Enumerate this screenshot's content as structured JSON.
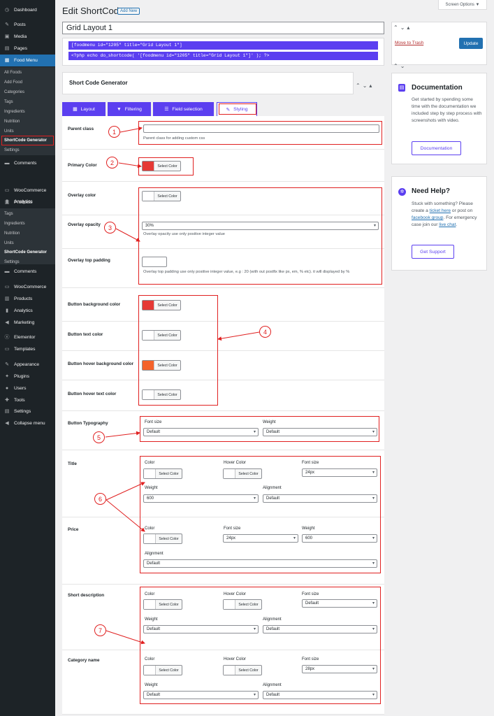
{
  "sidebar": {
    "items": [
      {
        "label": "Dashboard",
        "icon": "dashboard-icon",
        "glyph": "◷"
      },
      {
        "label": "Posts",
        "icon": "pin-icon",
        "glyph": "✎"
      },
      {
        "label": "Media",
        "icon": "media-icon",
        "glyph": "▣"
      },
      {
        "label": "Pages",
        "icon": "page-icon",
        "glyph": "▤"
      },
      {
        "label": "Food Menu",
        "icon": "food-menu-icon",
        "glyph": "▦"
      }
    ],
    "food_submenu": [
      "All Foods",
      "Add Food",
      "Categories",
      "Tags",
      "Ingredients",
      "Nutrition",
      "Units",
      "ShortCode Generator",
      "Settings"
    ],
    "items2": [
      {
        "label": "Comments",
        "icon": "comments-icon",
        "glyph": "▬"
      },
      {
        "label": "WooCommerce",
        "icon": "woocommerce-icon",
        "glyph": "▭"
      },
      {
        "label": "Products",
        "icon": "products-icon",
        "glyph": "▥"
      },
      {
        "label": "Analytics",
        "icon": "analytics-icon",
        "glyph": "▮"
      }
    ],
    "dup_submenu": [
      "Tags",
      "Ingredients",
      "Nutrition",
      "Units",
      "ShortCode Generator",
      "Settings"
    ],
    "items3": [
      {
        "label": "Comments",
        "icon": "comments-icon",
        "glyph": "▬"
      },
      {
        "label": "WooCommerce",
        "icon": "woocommerce-icon",
        "glyph": "▭"
      },
      {
        "label": "Products",
        "icon": "products-icon",
        "glyph": "▥"
      },
      {
        "label": "Analytics",
        "icon": "analytics-icon",
        "glyph": "▮"
      },
      {
        "label": "Marketing",
        "icon": "marketing-icon",
        "glyph": "◀"
      },
      {
        "label": "Elementor",
        "icon": "elementor-icon",
        "glyph": "ⓔ"
      },
      {
        "label": "Templates",
        "icon": "templates-icon",
        "glyph": "▭"
      },
      {
        "label": "Appearance",
        "icon": "appearance-icon",
        "glyph": "✎"
      },
      {
        "label": "Plugins",
        "icon": "plugins-icon",
        "glyph": "✦"
      },
      {
        "label": "Users",
        "icon": "users-icon",
        "glyph": "●"
      },
      {
        "label": "Tools",
        "icon": "tools-icon",
        "glyph": "✚"
      },
      {
        "label": "Settings",
        "icon": "settings-icon",
        "glyph": "▤"
      },
      {
        "label": "Collapse menu",
        "icon": "collapse-icon",
        "glyph": "◀"
      }
    ]
  },
  "header": {
    "title": "Edit ShortCode",
    "add_new": "Add New",
    "screen_options": "Screen Options ▼"
  },
  "post_title": "Grid Layout 1",
  "shortcodes": [
    "[foodmenu id=\"1205\" title=\"Grid Layout 1\"]",
    "<?php echo do_shortcode( '[foodmenu id=\"1205\" title=\"Grid Layout 1\"]' ); ?>"
  ],
  "generator": {
    "title": "Short Code Generator",
    "tabs": [
      "Layout",
      "Filtering",
      "Field selection",
      "Styling"
    ]
  },
  "colors": {
    "accent": "#5b3ff0",
    "red": "#e02020",
    "red_swatch": "#e53935",
    "orange_swatch": "#f4622a",
    "wp_blue": "#2271b1"
  },
  "select_color": "Select Color",
  "fields": {
    "parent_class": {
      "label": "Parent class",
      "help": "Parent class for adding custom css"
    },
    "primary_color": {
      "label": "Primary Color"
    },
    "overlay_color": {
      "label": "Overlay color"
    },
    "overlay_opacity": {
      "label": "Overlay opacity",
      "value": "30%",
      "help": "Overlay opacity use only positive integer value"
    },
    "overlay_top_padding": {
      "label": "Overlay top padding",
      "help": "Overlay top padding use only positive integer value, e.g : 20 (with out postfix like px, em, % etc). it will displayed by %"
    },
    "button_bg": {
      "label": "Button background color"
    },
    "button_text": {
      "label": "Button text color"
    },
    "button_hover_bg": {
      "label": "Button hover background color"
    },
    "button_hover_text": {
      "label": "Button hover text color"
    },
    "button_typography": {
      "label": "Button Typography",
      "font_size_label": "Font size",
      "font_size": "Default",
      "weight_label": "Weight",
      "weight": "Default"
    },
    "title": {
      "label": "Title",
      "color": "Color",
      "hover_color": "Hover Color",
      "font_size_label": "Font size",
      "font_size": "24px",
      "weight_label": "Weight",
      "weight": "600",
      "alignment_label": "Alignment",
      "alignment": "Default"
    },
    "price": {
      "label": "Price",
      "color": "Color",
      "font_size_label": "Font size",
      "font_size": "24px",
      "weight_label": "Weight",
      "weight": "600",
      "alignment_label": "Alignment",
      "alignment": "Default"
    },
    "short_desc": {
      "label": "Short description",
      "color": "Color",
      "hover_color": "Hover Color",
      "font_size_label": "Font size",
      "font_size": "Default",
      "weight_label": "Weight",
      "weight": "Default",
      "alignment_label": "Alignment",
      "alignment": "Default"
    },
    "category": {
      "label": "Category name",
      "color": "Color",
      "hover_color": "Hover Color",
      "font_size_label": "Font size",
      "font_size": "28px",
      "weight_label": "Weight",
      "weight": "Default",
      "alignment_label": "Alignment",
      "alignment": "Default"
    }
  },
  "callouts": [
    "1",
    "2",
    "3",
    "4",
    "5",
    "6",
    "7"
  ],
  "publish": {
    "trash": "Move to Trash",
    "update": "Update"
  },
  "docs": {
    "title": "Documentation",
    "text": "Get started by spending some time with the documentation we included step by step process with screenshots with video.",
    "button": "Documentation"
  },
  "help_box": {
    "title": "Need Help?",
    "t1": "Stuck with something? Please create a ",
    "link1": "ticket here",
    "t2": " or post on ",
    "link2": "facebook group",
    "t3": ". For emergency case join our ",
    "link3": "live chat",
    "t4": ".",
    "button": "Get Support"
  }
}
